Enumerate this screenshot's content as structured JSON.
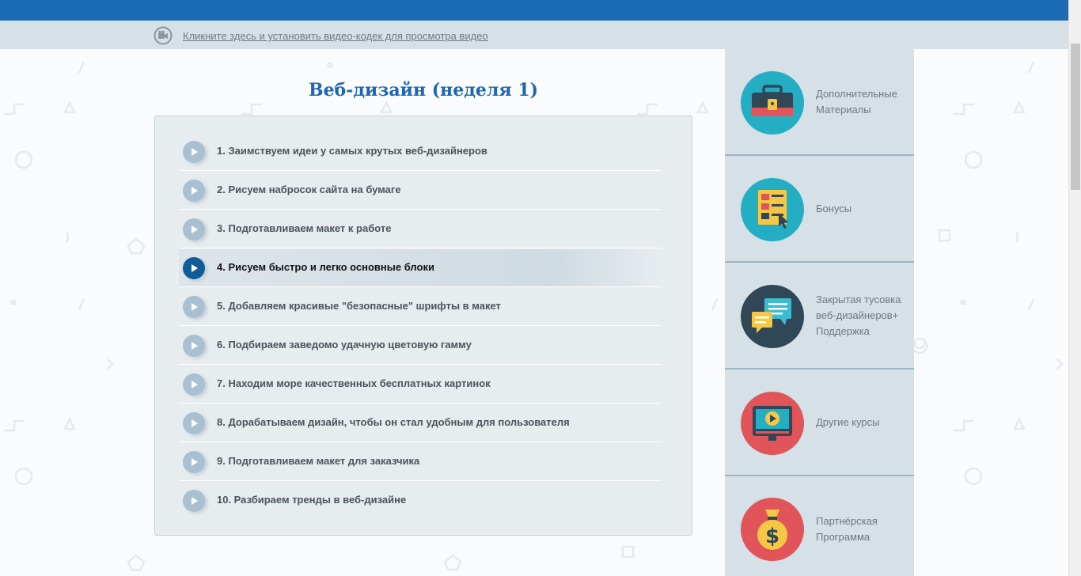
{
  "codec": {
    "link_text": "Кликните здесь и установить видео-кодек для просмотра видео",
    "icon": "video-camera-icon"
  },
  "page": {
    "title": "Веб-дизайн (неделя 1)"
  },
  "lessons": [
    {
      "label": "1. Заимствуем идеи у самых крутых веб-дизайнеров",
      "active": false
    },
    {
      "label": "2. Рисуем набросок сайта на бумаге",
      "active": false
    },
    {
      "label": "3. Подготавливаем макет к работе",
      "active": false
    },
    {
      "label": "4. Рисуем быстро и легко основные блоки",
      "active": true
    },
    {
      "label": "5. Добавляем красивые \"безопасные\" шрифты в макет",
      "active": false
    },
    {
      "label": "6. Подбираем заведомо удачную цветовую гамму",
      "active": false
    },
    {
      "label": "7. Находим море качественных бесплатных картинок",
      "active": false
    },
    {
      "label": "8. Дорабатываем дизайн, чтобы он стал удобным для пользователя",
      "active": false
    },
    {
      "label": "9. Подготавливаем макет для заказчика",
      "active": false
    },
    {
      "label": "10. Разбираем тренды в веб-дизайне",
      "active": false
    }
  ],
  "sidebar": {
    "items": [
      {
        "line1": "Дополнительные",
        "line2": "Материалы",
        "line3": "",
        "icon": "briefcase-icon",
        "color": "#24aec4"
      },
      {
        "line1": "Бонусы",
        "line2": "",
        "line3": "",
        "icon": "document-icon",
        "color": "#24aec4"
      },
      {
        "line1": "Закрытая тусовка",
        "line2": "веб-дизайнеров+",
        "line3": "Поддержка",
        "icon": "chat-icon",
        "color": "#2f4756"
      },
      {
        "line1": "Другие курсы",
        "line2": "",
        "line3": "",
        "icon": "video-player-icon",
        "color": "#e1555a"
      },
      {
        "line1": "Партнёрская",
        "line2": "Программа",
        "line3": "",
        "icon": "money-bag-icon",
        "color": "#e1555a"
      }
    ]
  },
  "colors": {
    "topbar": "#1b6cb4",
    "title": "#1d66b0",
    "active_play": "#0f5c99",
    "inactive_play": "#a9c0d3"
  }
}
